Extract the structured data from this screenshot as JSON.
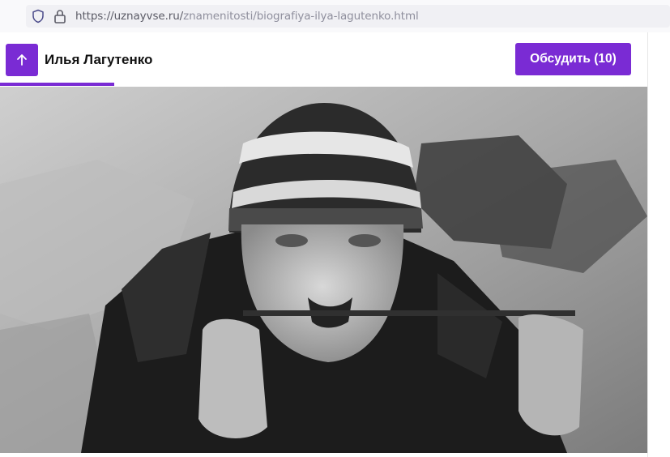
{
  "browser": {
    "url_host": "https://uznayvse.ru/",
    "url_path": "znamenitosti/biografiya-ilya-lagutenko.html",
    "icons": [
      "shield-icon",
      "lock-icon"
    ]
  },
  "header": {
    "title": "Илья Лагутенко",
    "scroll_up_icon": "arrow-up-icon",
    "discuss_label": "Обсудить (10)",
    "progress": 0.176,
    "accent_color": "#7a2bd4"
  },
  "photo": {
    "style": "black-and-white"
  }
}
